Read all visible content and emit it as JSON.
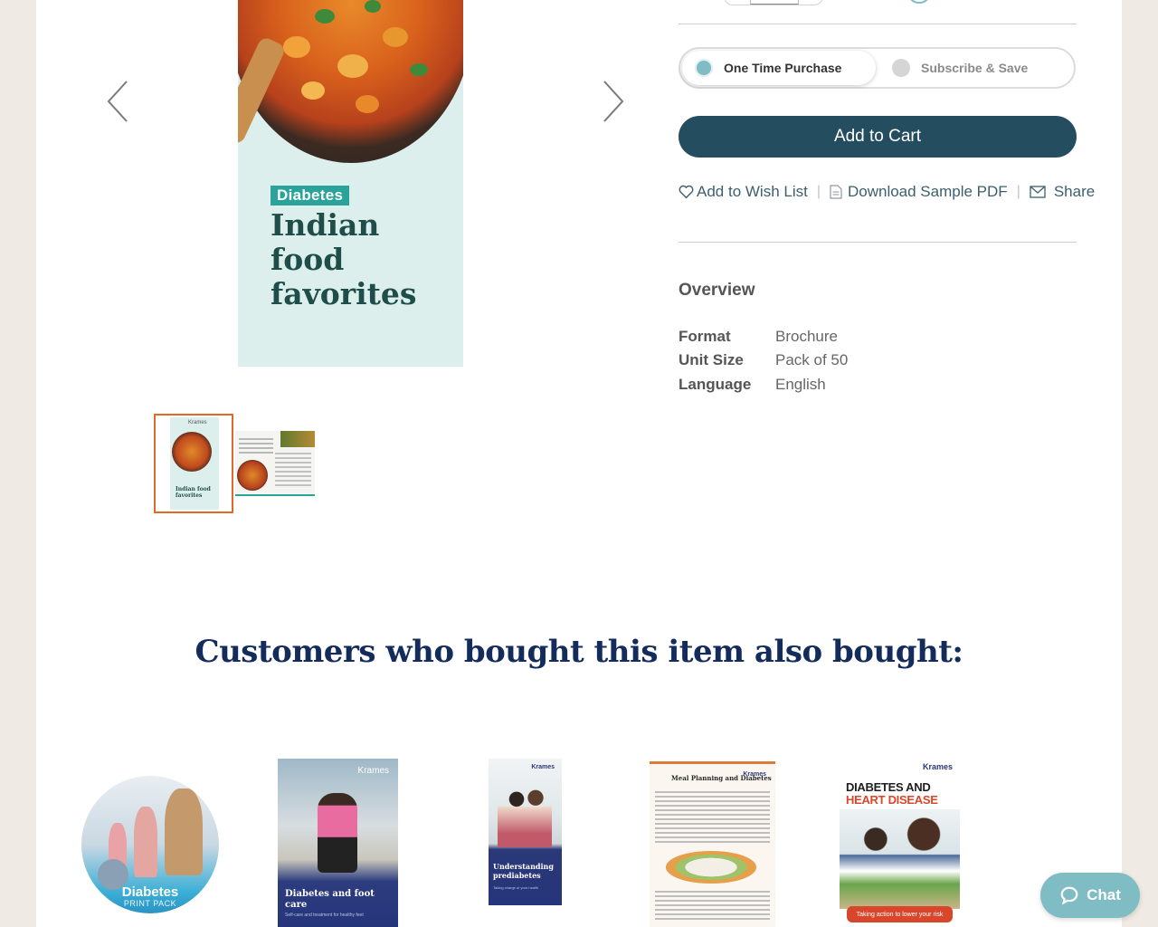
{
  "product": {
    "cover": {
      "tag": "Diabetes",
      "title": "Indian food favorites",
      "thumb_brand": "Krames",
      "thumb_title": "Indian food favorites"
    },
    "purchase_options": [
      "One Time Purchase",
      "Subscribe & Save"
    ],
    "selected_option": "One Time Purchase",
    "add_to_cart": "Add to Cart",
    "actions": {
      "wishlist": "Add to Wish List",
      "download": "Download Sample PDF",
      "share": "Share",
      "separator": "|"
    },
    "overview": {
      "title": "Overview",
      "specs": [
        {
          "label": "Format",
          "value": "Brochure"
        },
        {
          "label": "Unit Size",
          "value": "Pack of 50"
        },
        {
          "label": "Language",
          "value": "English"
        }
      ]
    }
  },
  "recommendations": {
    "heading": "Customers who bought this item also bought:",
    "items": [
      {
        "title": "Diabetes",
        "subtitle": "PRINT PACK"
      },
      {
        "brand": "Krames",
        "title": "Diabetes and foot care",
        "subtitle": "Self-care and treatment for healthy feet"
      },
      {
        "brand": "Krames",
        "title": "Understanding prediabetes",
        "subtitle": "Taking charge of your health"
      },
      {
        "brand": "Krames",
        "title": "Meal Planning and Diabetes"
      },
      {
        "brand": "Krames",
        "title_line1": "DIABETES AND",
        "title_line2": "HEART DISEASE",
        "banner": "Taking action to lower your risk"
      }
    ]
  },
  "chat": {
    "label": "Chat"
  },
  "colors": {
    "accent": "#244e5f",
    "teal": "#7fbcc4",
    "heading": "#142c5c",
    "thumb_border": "#e06a2a"
  }
}
